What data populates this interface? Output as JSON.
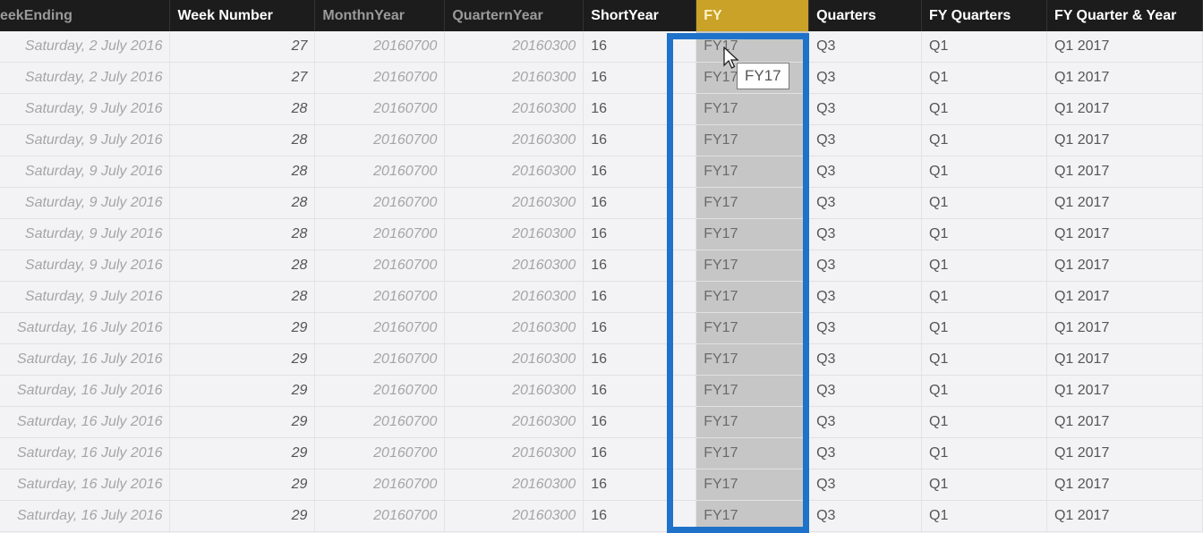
{
  "table": {
    "columns": [
      {
        "label": "eekEnding",
        "style": "dim"
      },
      {
        "label": "Week Number",
        "style": "bold"
      },
      {
        "label": "MonthnYear",
        "style": "dim"
      },
      {
        "label": "QuarternYear",
        "style": "dim"
      },
      {
        "label": "ShortYear",
        "style": "bold"
      },
      {
        "label": "FY",
        "style": "selected"
      },
      {
        "label": "Quarters",
        "style": "bold"
      },
      {
        "label": "FY Quarters",
        "style": "bold"
      },
      {
        "label": "FY Quarter & Year",
        "style": "bold"
      }
    ],
    "rows": [
      [
        "Saturday, 2 July 2016",
        "27",
        "20160700",
        "20160300",
        "16",
        "FY17",
        "Q3",
        "Q1",
        "Q1 2017"
      ],
      [
        "Saturday, 2 July 2016",
        "27",
        "20160700",
        "20160300",
        "16",
        "FY17",
        "Q3",
        "Q1",
        "Q1 2017"
      ],
      [
        "Saturday, 9 July 2016",
        "28",
        "20160700",
        "20160300",
        "16",
        "FY17",
        "Q3",
        "Q1",
        "Q1 2017"
      ],
      [
        "Saturday, 9 July 2016",
        "28",
        "20160700",
        "20160300",
        "16",
        "FY17",
        "Q3",
        "Q1",
        "Q1 2017"
      ],
      [
        "Saturday, 9 July 2016",
        "28",
        "20160700",
        "20160300",
        "16",
        "FY17",
        "Q3",
        "Q1",
        "Q1 2017"
      ],
      [
        "Saturday, 9 July 2016",
        "28",
        "20160700",
        "20160300",
        "16",
        "FY17",
        "Q3",
        "Q1",
        "Q1 2017"
      ],
      [
        "Saturday, 9 July 2016",
        "28",
        "20160700",
        "20160300",
        "16",
        "FY17",
        "Q3",
        "Q1",
        "Q1 2017"
      ],
      [
        "Saturday, 9 July 2016",
        "28",
        "20160700",
        "20160300",
        "16",
        "FY17",
        "Q3",
        "Q1",
        "Q1 2017"
      ],
      [
        "Saturday, 9 July 2016",
        "28",
        "20160700",
        "20160300",
        "16",
        "FY17",
        "Q3",
        "Q1",
        "Q1 2017"
      ],
      [
        "Saturday, 16 July 2016",
        "29",
        "20160700",
        "20160300",
        "16",
        "FY17",
        "Q3",
        "Q1",
        "Q1 2017"
      ],
      [
        "Saturday, 16 July 2016",
        "29",
        "20160700",
        "20160300",
        "16",
        "FY17",
        "Q3",
        "Q1",
        "Q1 2017"
      ],
      [
        "Saturday, 16 July 2016",
        "29",
        "20160700",
        "20160300",
        "16",
        "FY17",
        "Q3",
        "Q1",
        "Q1 2017"
      ],
      [
        "Saturday, 16 July 2016",
        "29",
        "20160700",
        "20160300",
        "16",
        "FY17",
        "Q3",
        "Q1",
        "Q1 2017"
      ],
      [
        "Saturday, 16 July 2016",
        "29",
        "20160700",
        "20160300",
        "16",
        "FY17",
        "Q3",
        "Q1",
        "Q1 2017"
      ],
      [
        "Saturday, 16 July 2016",
        "29",
        "20160700",
        "20160300",
        "16",
        "FY17",
        "Q3",
        "Q1",
        "Q1 2017"
      ],
      [
        "Saturday, 16 July 2016",
        "29",
        "20160700",
        "20160300",
        "16",
        "FY17",
        "Q3",
        "Q1",
        "Q1 2017"
      ]
    ]
  },
  "tooltip": {
    "text": "FY17"
  },
  "colors": {
    "selection_border": "#1e72c9",
    "selected_header": "#c9a227"
  }
}
